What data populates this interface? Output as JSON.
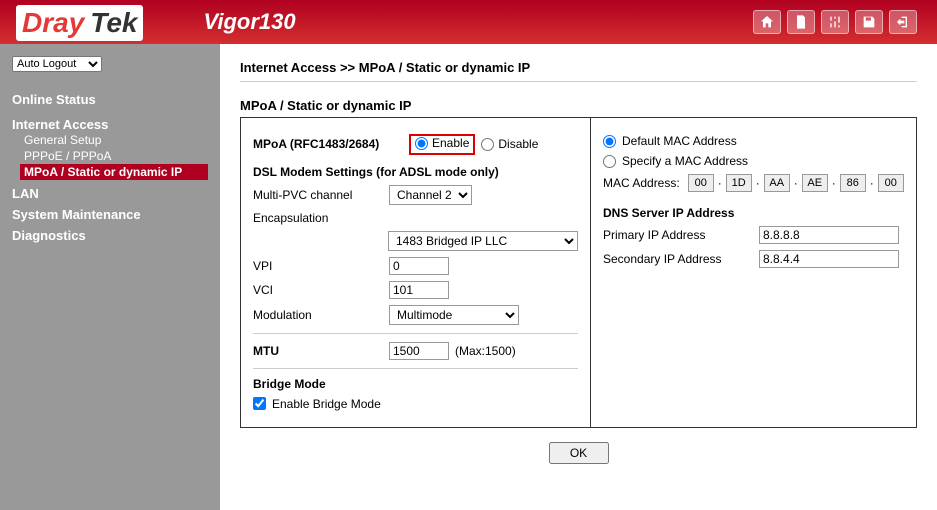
{
  "header": {
    "logo1": "Dray",
    "logo2": "Tek",
    "model": "Vigor130"
  },
  "sidebar": {
    "logout": "Auto Logout",
    "status": "Online Status",
    "internet": "Internet Access",
    "items": {
      "general": "General Setup",
      "pppoe": "PPPoE / PPPoA",
      "mpoa": "MPoA / Static or dynamic IP"
    },
    "lan": "LAN",
    "sys": "System Maintenance",
    "diag": "Diagnostics"
  },
  "breadcrumb": "Internet Access >> MPoA / Static or dynamic IP",
  "section_title": "MPoA / Static or dynamic IP",
  "left": {
    "mpoa_label": "MPoA (RFC1483/2684)",
    "enable": "Enable",
    "disable": "Disable",
    "dsl_heading": "DSL Modem Settings (for ADSL mode only)",
    "multi_pvc": "Multi-PVC channel",
    "multi_pvc_val": "Channel 2",
    "encap": "Encapsulation",
    "encap_val": "1483 Bridged IP LLC",
    "vpi": "VPI",
    "vpi_val": "0",
    "vci": "VCI",
    "vci_val": "101",
    "mod": "Modulation",
    "mod_val": "Multimode",
    "mtu": "MTU",
    "mtu_val": "1500",
    "mtu_max": "(Max:1500)",
    "bridge_hd": "Bridge Mode",
    "bridge_lbl": "Enable Bridge Mode"
  },
  "right": {
    "def_mac": "Default MAC Address",
    "spec_mac": "Specify a MAC Address",
    "mac_label": "MAC Address:",
    "mac": [
      "00",
      "1D",
      "AA",
      "AE",
      "86",
      "00"
    ],
    "dns_hd": "DNS Server IP Address",
    "prim": "Primary IP Address",
    "prim_val": "8.8.8.8",
    "sec": "Secondary IP Address",
    "sec_val": "8.8.4.4"
  },
  "ok": "OK"
}
